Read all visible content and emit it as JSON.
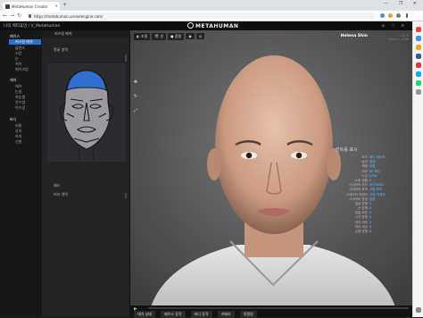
{
  "browser": {
    "tab_title": "MetaHuman Creator",
    "url": "https://metahuman.unrealengine.com/",
    "controls": "— ❐ ✕"
  },
  "app": {
    "title": "나의 메타휴먼 / V_MetaHuman",
    "logo": "METAHUMAN",
    "header_right": "⊞ ⓘ ⚙"
  },
  "nav": {
    "sections": [
      {
        "label": "페이스",
        "items": [
          "커스텀 메쉬",
          "블렌드",
          "스킨",
          "눈",
          "치아",
          "메이크업"
        ]
      },
      {
        "label": "헤어",
        "items": [
          "헤어",
          "눈썹",
          "속눈썹",
          "콧수염",
          "턱수염"
        ]
      },
      {
        "label": "바디",
        "items": [
          "비율",
          "상의",
          "하의",
          "신발"
        ]
      }
    ],
    "active_item": "커스텀 메쉬"
  },
  "panel": {
    "header": "커스텀 메쉬",
    "sub_label": "얼굴 영역",
    "rows": [
      "패드",
      "머리 영역"
    ]
  },
  "viewport": {
    "toolbar": [
      "◐ 조명",
      "🎬 씬",
      "● 품질",
      "◉",
      "◎"
    ],
    "character_name": "Helena Shin",
    "ghost_text": [
      "LOD 0",
      "1920 × 1080"
    ],
    "tools": [
      "✥",
      "↻",
      "⤢"
    ],
    "overlay": {
      "title": "컨트롤 표시",
      "rows": [
        {
          "k": "모드",
          "v": "바디 쉐이프"
        },
        {
          "k": "높이",
          "v": "평균"
        },
        {
          "k": "체형",
          "v": "보통"
        },
        {
          "k": "피부",
          "v": "BY 레드"
        },
        {
          "k": "스킨",
          "v": "LOW"
        },
        {
          "k": "노출 결합",
          "v": "0"
        },
        {
          "k": "시네마틱 모드",
          "v": "SSTRING"
        },
        {
          "k": "시네마틱 포즈",
          "v": "고정 포즈"
        },
        {
          "k": "시네마틱 카메라",
          "v": "고정 카메라"
        },
        {
          "k": "시네마틱 표정",
          "v": "없음"
        },
        {
          "k": "얼굴 방향",
          "v": "0"
        },
        {
          "k": "눈 방향",
          "v": "0"
        },
        {
          "k": "얼굴 회전",
          "v": "0"
        },
        {
          "k": "시선 방향",
          "v": "0"
        },
        {
          "k": "머리 세부",
          "v": "0"
        },
        {
          "k": "머리 색상",
          "v": "0"
        },
        {
          "k": "눈썹 방향",
          "v": "0"
        }
      ]
    }
  },
  "bottombar": {
    "play": "▶",
    "buttons": [
      "대기 상태",
      "페이스 동작",
      "바디 동작",
      "카메라",
      "정렬됨"
    ]
  }
}
